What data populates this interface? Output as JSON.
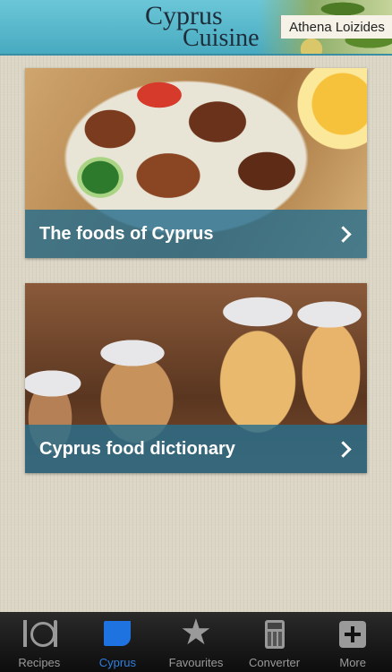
{
  "header": {
    "logo_line1": "Cyprus",
    "logo_line2": "Cuisine",
    "author": "Athena Loizides"
  },
  "cards": [
    {
      "title": "The foods of Cyprus",
      "icon": "chevron-right-icon"
    },
    {
      "title": "Cyprus food dictionary",
      "icon": "chevron-right-icon"
    }
  ],
  "tabbar": {
    "tabs": [
      {
        "label": "Recipes",
        "icon": "plate-cutlery-icon"
      },
      {
        "label": "Cyprus",
        "icon": "cyprus-map-icon",
        "active": true
      },
      {
        "label": "Favourites",
        "icon": "star-icon"
      },
      {
        "label": "Converter",
        "icon": "calculator-icon"
      },
      {
        "label": "More",
        "icon": "plus-box-icon"
      }
    ]
  },
  "colors": {
    "header": "#5bb9cc",
    "banner": "#286e8c",
    "active_tab": "#2f7fe0"
  }
}
